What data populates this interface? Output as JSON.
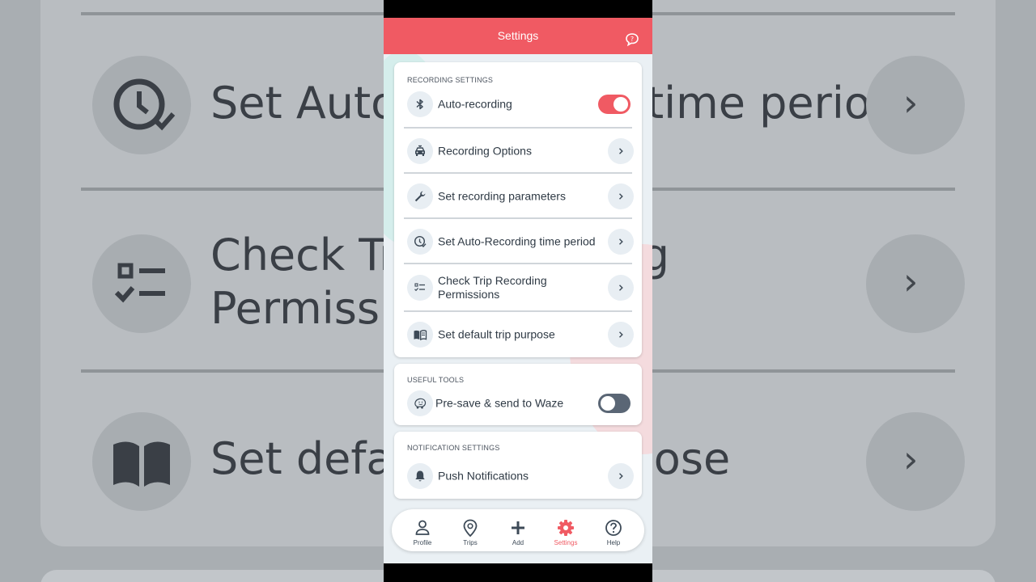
{
  "background": {
    "rows": [
      {
        "text": "Set Auto-Recording time period"
      },
      {
        "text_line1": "Check Trip Recording",
        "text_line2": "Permissions"
      },
      {
        "text": "Set default trip purpose"
      }
    ]
  },
  "header": {
    "title": "Settings",
    "icon": "chat-help-icon"
  },
  "recording": {
    "section_label": "RECORDING SETTINGS",
    "items": [
      {
        "label": "Auto-recording",
        "icon": "bluetooth-icon",
        "control": "toggle",
        "on": true
      },
      {
        "label": "Recording Options",
        "icon": "car-icon",
        "control": "chevron"
      },
      {
        "label": "Set recording parameters",
        "icon": "wrench-icon",
        "control": "chevron"
      },
      {
        "label": "Set Auto-Recording time period",
        "icon": "clock-check-icon",
        "control": "chevron"
      },
      {
        "label": "Check Trip Recording Permissions",
        "icon": "checklist-icon",
        "control": "chevron"
      },
      {
        "label": "Set default trip purpose",
        "icon": "book-icon",
        "control": "chevron"
      }
    ]
  },
  "tools": {
    "section_label": "USEFUL TOOLS",
    "items": [
      {
        "label": "Pre-save & send to Waze",
        "icon": "waze-icon",
        "control": "toggle",
        "on": false
      }
    ]
  },
  "notifications": {
    "section_label": "NOTIFICATION SETTINGS",
    "items": [
      {
        "label": "Push Notifications",
        "icon": "bell-icon",
        "control": "chevron"
      }
    ]
  },
  "nav": {
    "items": [
      {
        "label": "Profile",
        "icon": "person-icon",
        "active": false
      },
      {
        "label": "Trips",
        "icon": "map-pin-icon",
        "active": false
      },
      {
        "label": "Add",
        "icon": "plus-icon",
        "active": false
      },
      {
        "label": "Settings",
        "icon": "gear-icon",
        "active": true
      },
      {
        "label": "Help",
        "icon": "help-icon",
        "active": false
      }
    ]
  },
  "colors": {
    "accent": "#f05a63",
    "text": "#2f3a45",
    "icon_bg": "#e8eef3",
    "toggle_off": "#5a6675"
  }
}
